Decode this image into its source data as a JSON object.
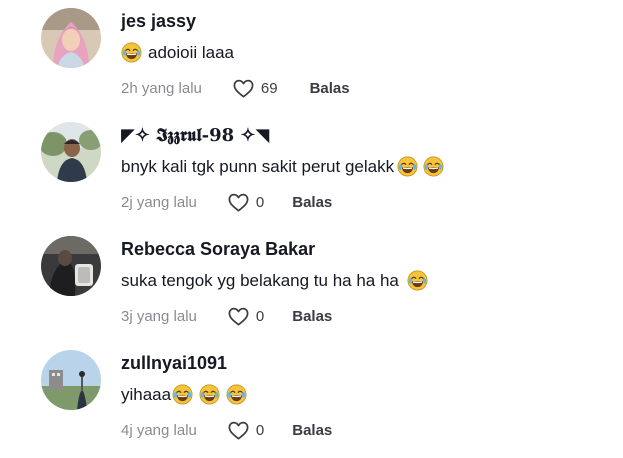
{
  "comments": [
    {
      "username": "jes jassy",
      "text": "adoioii laaa",
      "time": "2h yang lalu",
      "likes": "69",
      "reply": "Balas",
      "avatar": "woman-in-hijab-avatar",
      "emojis": [
        "face-with-tears-of-joy-emoji"
      ]
    },
    {
      "username": "◤✧ 𝕴𝖟𝖟𝖗𝖚𝖑-98 ✧◥",
      "text": "bnyk kali tgk punn sakit perut gelakk",
      "time": "2j yang lalu",
      "likes": "0",
      "reply": "Balas",
      "avatar": "man-outdoors-avatar",
      "emojis": [
        "face-with-tears-of-joy-emoji",
        "face-with-tears-of-joy-emoji"
      ]
    },
    {
      "username": "Rebecca Soraya Bakar",
      "text": "suka tengok yg belakang tu ha ha ha",
      "time": "3j yang lalu",
      "likes": "0",
      "reply": "Balas",
      "avatar": "dark-photo-avatar",
      "emojis": [
        "face-with-tears-of-joy-emoji"
      ]
    },
    {
      "username": "zullnyai1091",
      "text": "yihaaa",
      "time": "4j yang lalu",
      "likes": "0",
      "reply": "Balas",
      "avatar": "sky-field-avatar",
      "emojis": [
        "face-with-tears-of-joy-emoji",
        "face-with-tears-of-joy-emoji",
        "face-with-tears-of-joy-emoji"
      ]
    }
  ],
  "colors": {
    "username": "#161823",
    "timestamp": "#8a8b91",
    "action": "#3b3c43",
    "emoji_face": "#f6c43c"
  },
  "icons": {
    "like": "heart-outline-icon"
  }
}
